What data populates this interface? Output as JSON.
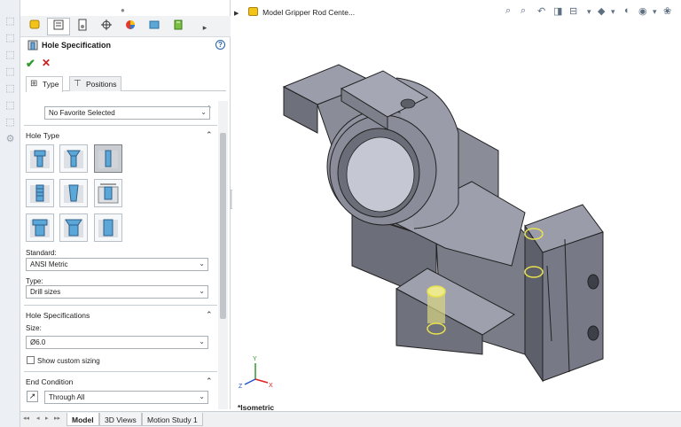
{
  "breadcrumb": {
    "document": "Model Gripper Rod Cente..."
  },
  "property_manager": {
    "title": "Hole Specification",
    "tabs": [
      {
        "label": "Type"
      },
      {
        "label": "Positions"
      }
    ],
    "favorite": {
      "value": "No Favorite Selected"
    },
    "hole_type": {
      "title": "Hole Type",
      "buttons": [
        "counterbore",
        "countersink",
        "hole",
        "straight-tap",
        "tapered-tap",
        "legacy",
        "counterbore-slot",
        "countersink-slot",
        "slot"
      ],
      "selected": "hole"
    },
    "standard": {
      "label": "Standard:",
      "value": "ANSI Metric"
    },
    "type": {
      "label": "Type:",
      "value": "Drill sizes"
    },
    "hole_specifications": {
      "title": "Hole Specifications",
      "size_label": "Size:",
      "size_value": "Ø6.0",
      "custom_sizing_label": "Show custom sizing",
      "custom_sizing_checked": false
    },
    "end_condition": {
      "title": "End Condition",
      "value": "Through All"
    }
  },
  "view_orientation": "*Isometric",
  "bottom_tabs": [
    "Model",
    "3D Views",
    "Motion Study 1"
  ],
  "active_bottom_tab": "Model",
  "colors": {
    "part_face": "#8c8e9a",
    "part_dark": "#5c5e68",
    "highlight": "#e8e24c",
    "accent": "#2460a7"
  }
}
